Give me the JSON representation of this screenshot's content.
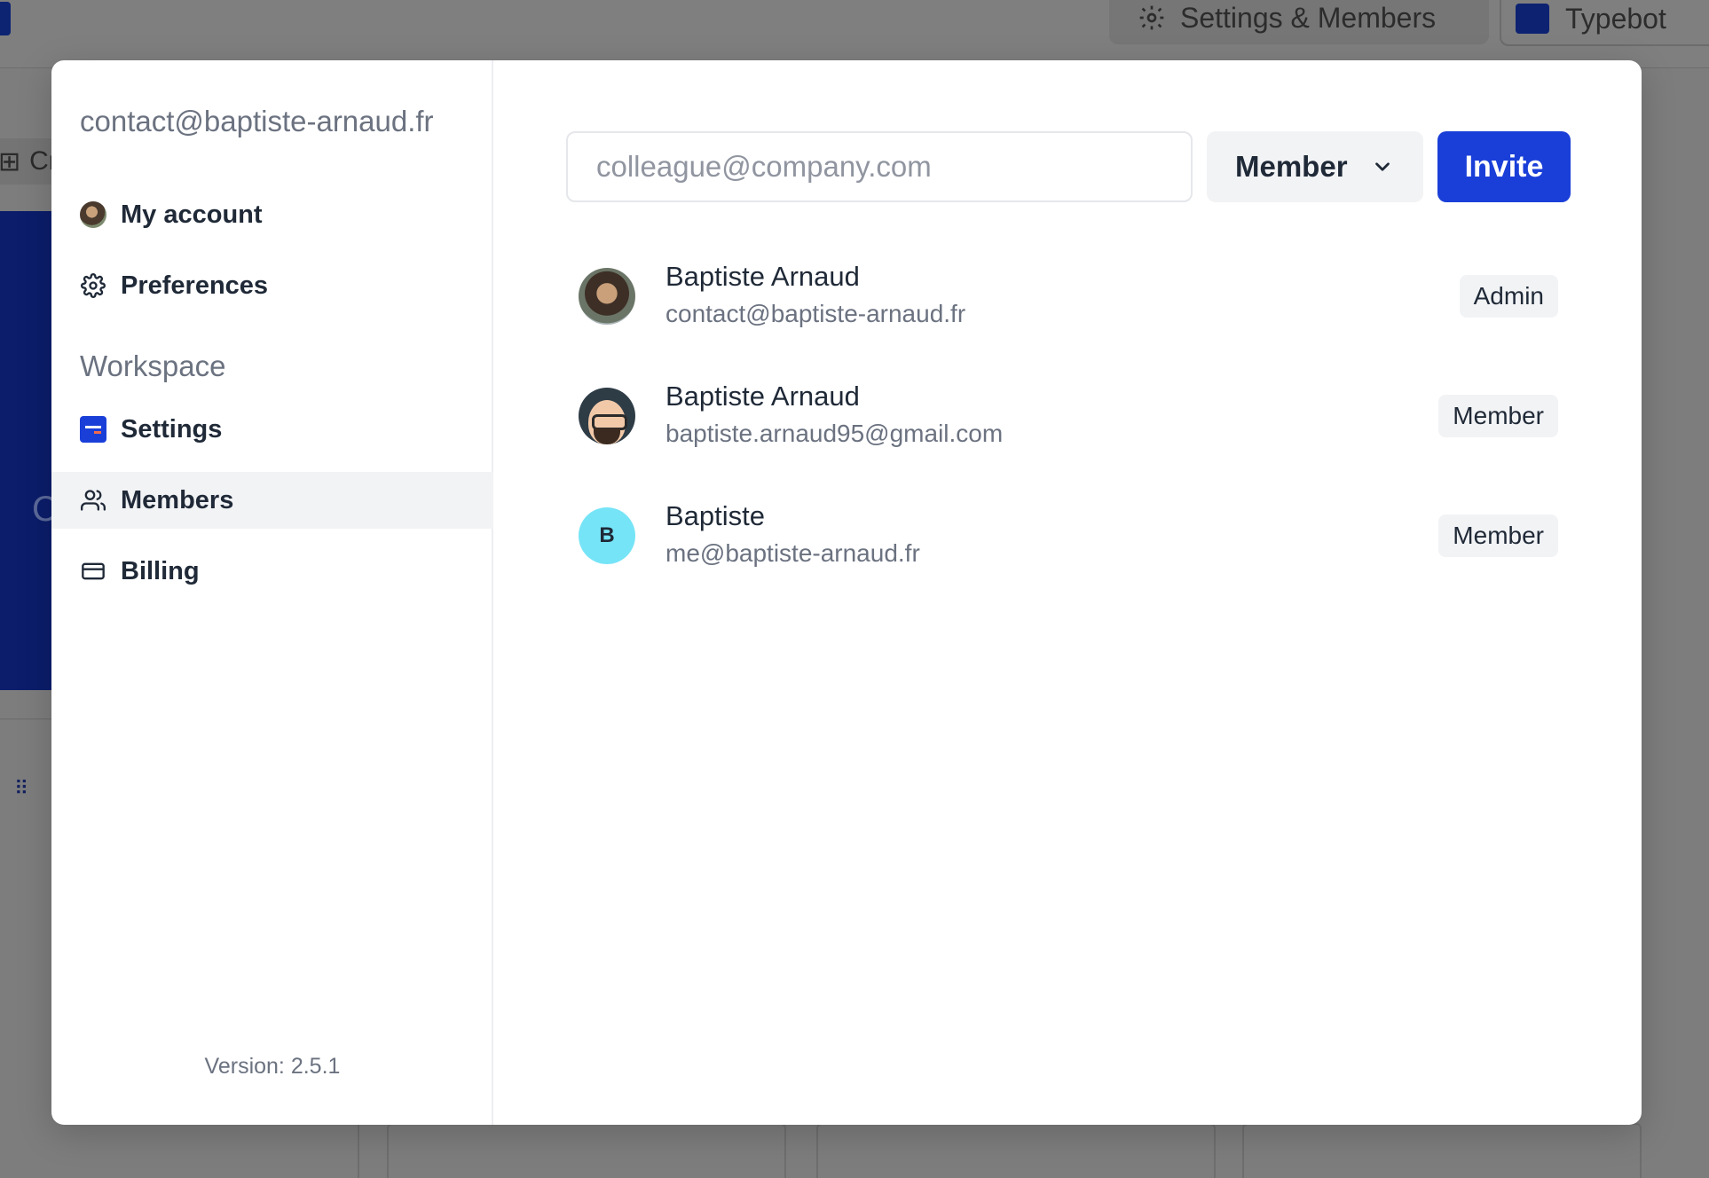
{
  "background": {
    "settings_button_label": "Settings & Members",
    "workspace_button_label": "Typebot",
    "create_tab_label": "Cr",
    "blue_panel_letter": "C"
  },
  "sidebar": {
    "account_email": "contact@baptiste-arnaud.fr",
    "account_items": [
      {
        "label": "My account",
        "icon": "avatar"
      },
      {
        "label": "Preferences",
        "icon": "gear-icon"
      }
    ],
    "workspace_section_label": "Workspace",
    "workspace_items": [
      {
        "label": "Settings",
        "icon": "workspace-logo-icon"
      },
      {
        "label": "Members",
        "icon": "users-icon",
        "active": true
      },
      {
        "label": "Billing",
        "icon": "credit-card-icon"
      }
    ],
    "version": "Version: 2.5.1"
  },
  "invite": {
    "placeholder": "colleague@company.com",
    "value": "",
    "role_selected": "Member",
    "invite_button_label": "Invite"
  },
  "members": [
    {
      "name": "Baptiste Arnaud",
      "email": "contact@baptiste-arnaud.fr",
      "role": "Admin",
      "avatar": "photo"
    },
    {
      "name": "Baptiste Arnaud",
      "email": "baptiste.arnaud95@gmail.com",
      "role": "Member",
      "avatar": "memoji"
    },
    {
      "name": "Baptiste",
      "email": "me@baptiste-arnaud.fr",
      "role": "Member",
      "avatar": "initial",
      "initial": "B"
    }
  ],
  "colors": {
    "accent": "#1a3fd8",
    "overlay": "#7f7f7f",
    "muted_text": "#6b7280",
    "active_nav_bg": "#f2f3f5",
    "initial_avatar_bg": "#76e4f7"
  }
}
